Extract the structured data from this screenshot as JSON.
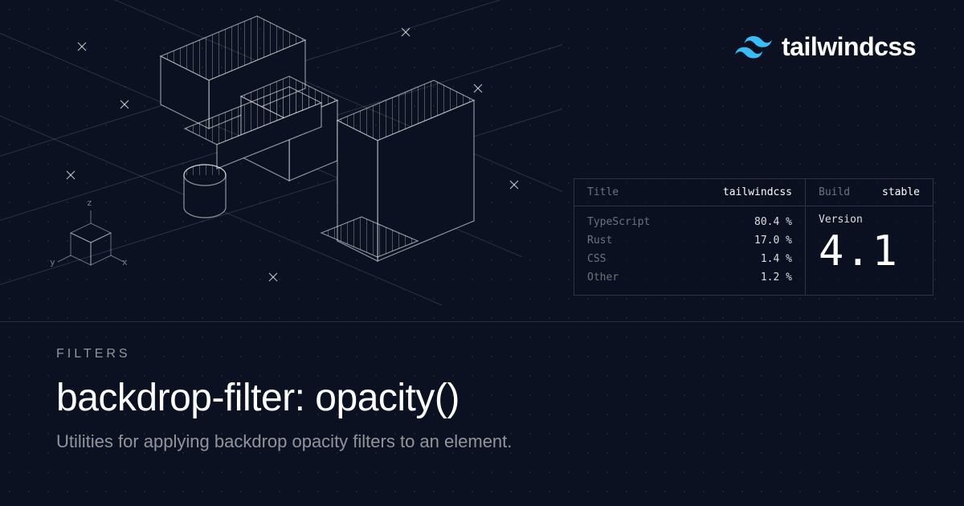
{
  "brand": {
    "name": "tailwindcss"
  },
  "panel": {
    "title_label": "Title",
    "title_value": "tailwindcss",
    "build_label": "Build",
    "build_value": "stable",
    "version_label": "Version",
    "version_value": "4.1",
    "langs": [
      {
        "name": "TypeScript",
        "pct": "80.4 %"
      },
      {
        "name": "Rust",
        "pct": "17.0 %"
      },
      {
        "name": "CSS",
        "pct": "1.4 %"
      },
      {
        "name": "Other",
        "pct": "1.2 %"
      }
    ]
  },
  "gizmo": {
    "x": "x",
    "y": "y",
    "z": "z"
  },
  "footer": {
    "kicker": "FILTERS",
    "title": "backdrop-filter: opacity()",
    "subtitle": "Utilities for applying backdrop opacity filters to an element."
  }
}
